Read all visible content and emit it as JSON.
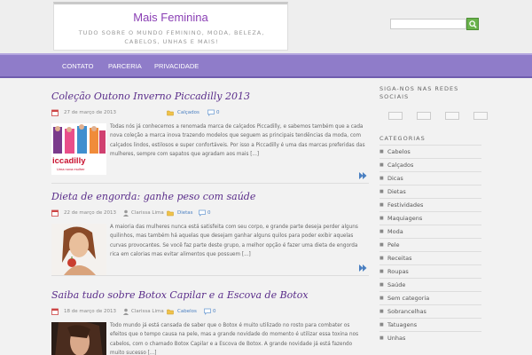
{
  "header": {
    "site_title": "Mais Feminina",
    "tagline": "TUDO SOBRE O MUNDO FEMININO, MODA, BELEZA, CABELOS, UNHAS E MAIS!",
    "search_placeholder": ""
  },
  "nav": {
    "items": [
      "CONTATO",
      "PARCERIA",
      "PRIVACIDADE"
    ]
  },
  "posts": [
    {
      "title": "Coleção Outono Inverno Piccadilly 2013",
      "date": "27 de março de 2013",
      "author": "",
      "category": "Calçados",
      "comments": "0",
      "thumb_caption": "iccadilly",
      "thumb_subcaption": "Uma nova mulher",
      "excerpt": "Todas nós já conhecemos a renomada marca de calçados Piccadilly, e sabemos também que a cada nova coleção a marca inova trazendo modelos que seguem as principais tendências da moda, com calçados lindos, estilosos e super confortáveis. Por isso a Piccadilly é uma das marcas preferidas das mulheres, sempre com sapatos que agradam aos mais [...]"
    },
    {
      "title": "Dieta de engorda: ganhe peso com saúde",
      "date": "22 de março de 2013",
      "author": "Clarissa Lima",
      "category": "Dietas",
      "comments": "0",
      "excerpt": "A maioria das mulheres nunca está satisfeita com seu corpo, e grande parte deseja perder alguns quilinhos, mas também há aquelas que desejam ganhar alguns quilos para poder exibir aquelas curvas provocantes. Se você faz parte deste grupo, a melhor opção é fazer uma dieta de engorda rica em calorias mas evitar alimentos que possuem [...]"
    },
    {
      "title": "Saiba tudo sobre Botox Capilar e a Escova de Botox",
      "date": "18 de março de 2013",
      "author": "Clarissa Lima",
      "category": "Cabelos",
      "comments": "0",
      "excerpt": "Todo mundo já está cansada de saber que o Botox é muito utilizado no rosto para combater os efeitos que o tempo causa na pele, mas a grande novidade do momento é utilizar essa toxina nos cabelos, com o chamado Botox Capilar e a Escova de Botox. A grande novidade já está fazendo muito sucesso [...]"
    }
  ],
  "sidebar": {
    "social_title": "SIGA-NOS NAS REDES SOCIAIS",
    "categories_title": "CATEGORIAS",
    "categories": [
      "Cabelos",
      "Calçados",
      "Dicas",
      "Dietas",
      "Festividades",
      "Maquiagens",
      "Moda",
      "Pele",
      "Receitas",
      "Roupas",
      "Saúde",
      "Sem categoria",
      "Sobrancelhas",
      "Tatuagens",
      "Unhas"
    ]
  },
  "colors": {
    "nav": "#8f7cc9",
    "title": "#5a2d8a",
    "link": "#4a7fc1",
    "search_button": "#6ab34c"
  }
}
